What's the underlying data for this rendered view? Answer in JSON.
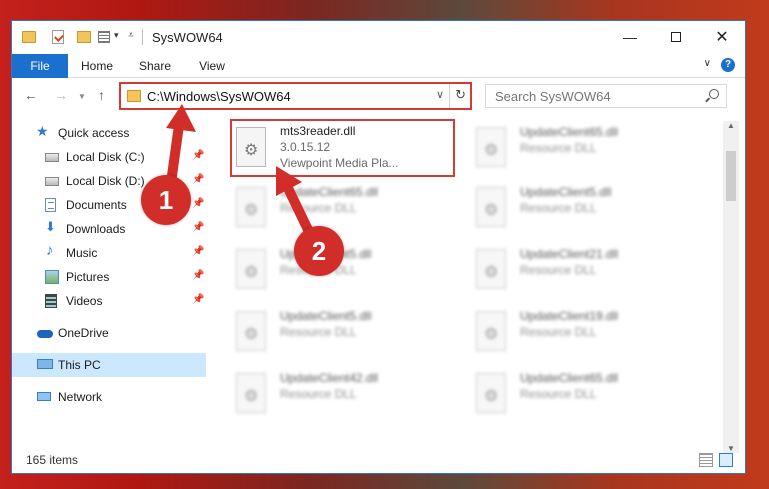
{
  "window": {
    "title": "SysWOW64",
    "controls": {
      "minimize": "—",
      "maximize": "",
      "close": "✕"
    }
  },
  "ribbon": {
    "tabs": [
      "File",
      "Home",
      "Share",
      "View"
    ],
    "help": "?"
  },
  "address": {
    "path": "C:\\Windows\\SysWOW64"
  },
  "search": {
    "placeholder": "Search SysWOW64"
  },
  "nav": {
    "quick_access": "Quick access",
    "items": [
      {
        "label": "Local Disk (C:)",
        "icon": "drive-icon",
        "pinned": true
      },
      {
        "label": "Local Disk (D:)",
        "icon": "drive-icon",
        "pinned": true
      },
      {
        "label": "Documents",
        "icon": "documents-icon",
        "pinned": true
      },
      {
        "label": "Downloads",
        "icon": "downloads-icon",
        "pinned": true
      },
      {
        "label": "Music",
        "icon": "music-icon",
        "pinned": true
      },
      {
        "label": "Pictures",
        "icon": "pictures-icon",
        "pinned": true
      },
      {
        "label": "Videos",
        "icon": "videos-icon",
        "pinned": true
      }
    ],
    "onedrive": "OneDrive",
    "this_pc": "This PC",
    "network": "Network"
  },
  "files": [
    {
      "name": "mts3reader.dll",
      "version": "3.0.15.12",
      "description": "Viewpoint Media Pla...",
      "highlighted": true
    },
    {
      "name": "UpdateClient65.dll",
      "description": "Resource DLL"
    },
    {
      "name": "UpdateClient65.dll",
      "description": "Resource DLL"
    },
    {
      "name": "UpdateClient5.dll",
      "description": "Resource DLL"
    },
    {
      "name": "UpdateClient5.dll",
      "description": "Resource DLL"
    },
    {
      "name": "UpdateClient21.dll",
      "description": "Resource DLL"
    },
    {
      "name": "UpdateClient5.dll",
      "description": "Resource DLL"
    },
    {
      "name": "UpdateClient19.dll",
      "description": "Resource DLL"
    },
    {
      "name": "UpdateClient42.dll",
      "description": "Resource DLL"
    },
    {
      "name": "UpdateClient65.dll",
      "description": "Resource DLL"
    }
  ],
  "status": {
    "count": "165 items"
  },
  "callouts": [
    "1",
    "2"
  ],
  "colors": {
    "accent": "#1a6fcf",
    "highlight": "#d63a34",
    "selection": "#cce8ff"
  }
}
